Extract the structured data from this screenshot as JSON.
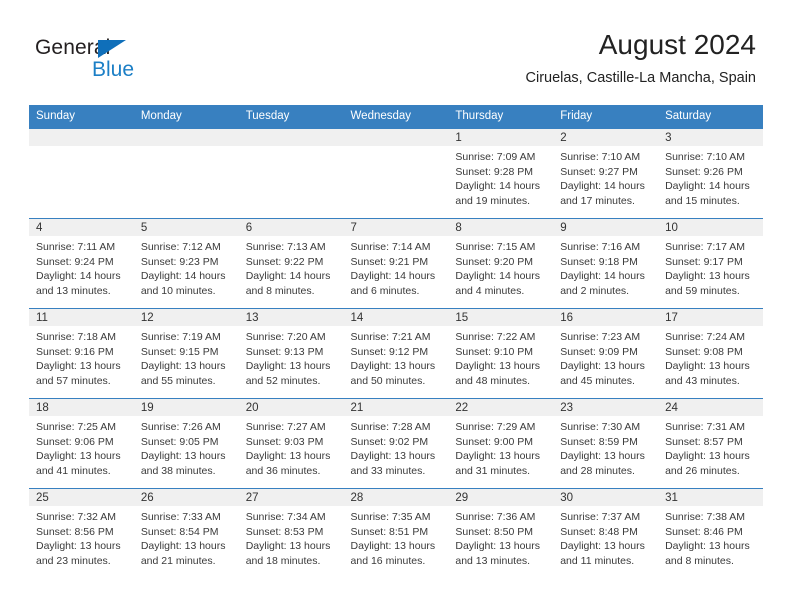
{
  "brand": {
    "name_part1": "General",
    "name_part2": "Blue",
    "accent_color": "#1c7fc6",
    "triangle_color": "#0f6fba"
  },
  "header": {
    "month_title": "August 2024",
    "location": "Ciruelas, Castille-La Mancha, Spain"
  },
  "theme": {
    "header_bg": "#3880c0",
    "daynum_bg": "#f0f0f0",
    "cell_bg": "#ffffff"
  },
  "calendar": {
    "weekday_headers": [
      "Sunday",
      "Monday",
      "Tuesday",
      "Wednesday",
      "Thursday",
      "Friday",
      "Saturday"
    ],
    "weeks": [
      [
        {
          "day": "",
          "empty": true
        },
        {
          "day": "",
          "empty": true
        },
        {
          "day": "",
          "empty": true
        },
        {
          "day": "",
          "empty": true
        },
        {
          "day": "1",
          "sunrise": "Sunrise: 7:09 AM",
          "sunset": "Sunset: 9:28 PM",
          "daylight1": "Daylight: 14 hours",
          "daylight2": "and 19 minutes."
        },
        {
          "day": "2",
          "sunrise": "Sunrise: 7:10 AM",
          "sunset": "Sunset: 9:27 PM",
          "daylight1": "Daylight: 14 hours",
          "daylight2": "and 17 minutes."
        },
        {
          "day": "3",
          "sunrise": "Sunrise: 7:10 AM",
          "sunset": "Sunset: 9:26 PM",
          "daylight1": "Daylight: 14 hours",
          "daylight2": "and 15 minutes."
        }
      ],
      [
        {
          "day": "4",
          "sunrise": "Sunrise: 7:11 AM",
          "sunset": "Sunset: 9:24 PM",
          "daylight1": "Daylight: 14 hours",
          "daylight2": "and 13 minutes."
        },
        {
          "day": "5",
          "sunrise": "Sunrise: 7:12 AM",
          "sunset": "Sunset: 9:23 PM",
          "daylight1": "Daylight: 14 hours",
          "daylight2": "and 10 minutes."
        },
        {
          "day": "6",
          "sunrise": "Sunrise: 7:13 AM",
          "sunset": "Sunset: 9:22 PM",
          "daylight1": "Daylight: 14 hours",
          "daylight2": "and 8 minutes."
        },
        {
          "day": "7",
          "sunrise": "Sunrise: 7:14 AM",
          "sunset": "Sunset: 9:21 PM",
          "daylight1": "Daylight: 14 hours",
          "daylight2": "and 6 minutes."
        },
        {
          "day": "8",
          "sunrise": "Sunrise: 7:15 AM",
          "sunset": "Sunset: 9:20 PM",
          "daylight1": "Daylight: 14 hours",
          "daylight2": "and 4 minutes."
        },
        {
          "day": "9",
          "sunrise": "Sunrise: 7:16 AM",
          "sunset": "Sunset: 9:18 PM",
          "daylight1": "Daylight: 14 hours",
          "daylight2": "and 2 minutes."
        },
        {
          "day": "10",
          "sunrise": "Sunrise: 7:17 AM",
          "sunset": "Sunset: 9:17 PM",
          "daylight1": "Daylight: 13 hours",
          "daylight2": "and 59 minutes."
        }
      ],
      [
        {
          "day": "11",
          "sunrise": "Sunrise: 7:18 AM",
          "sunset": "Sunset: 9:16 PM",
          "daylight1": "Daylight: 13 hours",
          "daylight2": "and 57 minutes."
        },
        {
          "day": "12",
          "sunrise": "Sunrise: 7:19 AM",
          "sunset": "Sunset: 9:15 PM",
          "daylight1": "Daylight: 13 hours",
          "daylight2": "and 55 minutes."
        },
        {
          "day": "13",
          "sunrise": "Sunrise: 7:20 AM",
          "sunset": "Sunset: 9:13 PM",
          "daylight1": "Daylight: 13 hours",
          "daylight2": "and 52 minutes."
        },
        {
          "day": "14",
          "sunrise": "Sunrise: 7:21 AM",
          "sunset": "Sunset: 9:12 PM",
          "daylight1": "Daylight: 13 hours",
          "daylight2": "and 50 minutes."
        },
        {
          "day": "15",
          "sunrise": "Sunrise: 7:22 AM",
          "sunset": "Sunset: 9:10 PM",
          "daylight1": "Daylight: 13 hours",
          "daylight2": "and 48 minutes."
        },
        {
          "day": "16",
          "sunrise": "Sunrise: 7:23 AM",
          "sunset": "Sunset: 9:09 PM",
          "daylight1": "Daylight: 13 hours",
          "daylight2": "and 45 minutes."
        },
        {
          "day": "17",
          "sunrise": "Sunrise: 7:24 AM",
          "sunset": "Sunset: 9:08 PM",
          "daylight1": "Daylight: 13 hours",
          "daylight2": "and 43 minutes."
        }
      ],
      [
        {
          "day": "18",
          "sunrise": "Sunrise: 7:25 AM",
          "sunset": "Sunset: 9:06 PM",
          "daylight1": "Daylight: 13 hours",
          "daylight2": "and 41 minutes."
        },
        {
          "day": "19",
          "sunrise": "Sunrise: 7:26 AM",
          "sunset": "Sunset: 9:05 PM",
          "daylight1": "Daylight: 13 hours",
          "daylight2": "and 38 minutes."
        },
        {
          "day": "20",
          "sunrise": "Sunrise: 7:27 AM",
          "sunset": "Sunset: 9:03 PM",
          "daylight1": "Daylight: 13 hours",
          "daylight2": "and 36 minutes."
        },
        {
          "day": "21",
          "sunrise": "Sunrise: 7:28 AM",
          "sunset": "Sunset: 9:02 PM",
          "daylight1": "Daylight: 13 hours",
          "daylight2": "and 33 minutes."
        },
        {
          "day": "22",
          "sunrise": "Sunrise: 7:29 AM",
          "sunset": "Sunset: 9:00 PM",
          "daylight1": "Daylight: 13 hours",
          "daylight2": "and 31 minutes."
        },
        {
          "day": "23",
          "sunrise": "Sunrise: 7:30 AM",
          "sunset": "Sunset: 8:59 PM",
          "daylight1": "Daylight: 13 hours",
          "daylight2": "and 28 minutes."
        },
        {
          "day": "24",
          "sunrise": "Sunrise: 7:31 AM",
          "sunset": "Sunset: 8:57 PM",
          "daylight1": "Daylight: 13 hours",
          "daylight2": "and 26 minutes."
        }
      ],
      [
        {
          "day": "25",
          "sunrise": "Sunrise: 7:32 AM",
          "sunset": "Sunset: 8:56 PM",
          "daylight1": "Daylight: 13 hours",
          "daylight2": "and 23 minutes."
        },
        {
          "day": "26",
          "sunrise": "Sunrise: 7:33 AM",
          "sunset": "Sunset: 8:54 PM",
          "daylight1": "Daylight: 13 hours",
          "daylight2": "and 21 minutes."
        },
        {
          "day": "27",
          "sunrise": "Sunrise: 7:34 AM",
          "sunset": "Sunset: 8:53 PM",
          "daylight1": "Daylight: 13 hours",
          "daylight2": "and 18 minutes."
        },
        {
          "day": "28",
          "sunrise": "Sunrise: 7:35 AM",
          "sunset": "Sunset: 8:51 PM",
          "daylight1": "Daylight: 13 hours",
          "daylight2": "and 16 minutes."
        },
        {
          "day": "29",
          "sunrise": "Sunrise: 7:36 AM",
          "sunset": "Sunset: 8:50 PM",
          "daylight1": "Daylight: 13 hours",
          "daylight2": "and 13 minutes."
        },
        {
          "day": "30",
          "sunrise": "Sunrise: 7:37 AM",
          "sunset": "Sunset: 8:48 PM",
          "daylight1": "Daylight: 13 hours",
          "daylight2": "and 11 minutes."
        },
        {
          "day": "31",
          "sunrise": "Sunrise: 7:38 AM",
          "sunset": "Sunset: 8:46 PM",
          "daylight1": "Daylight: 13 hours",
          "daylight2": "and 8 minutes."
        }
      ]
    ]
  }
}
